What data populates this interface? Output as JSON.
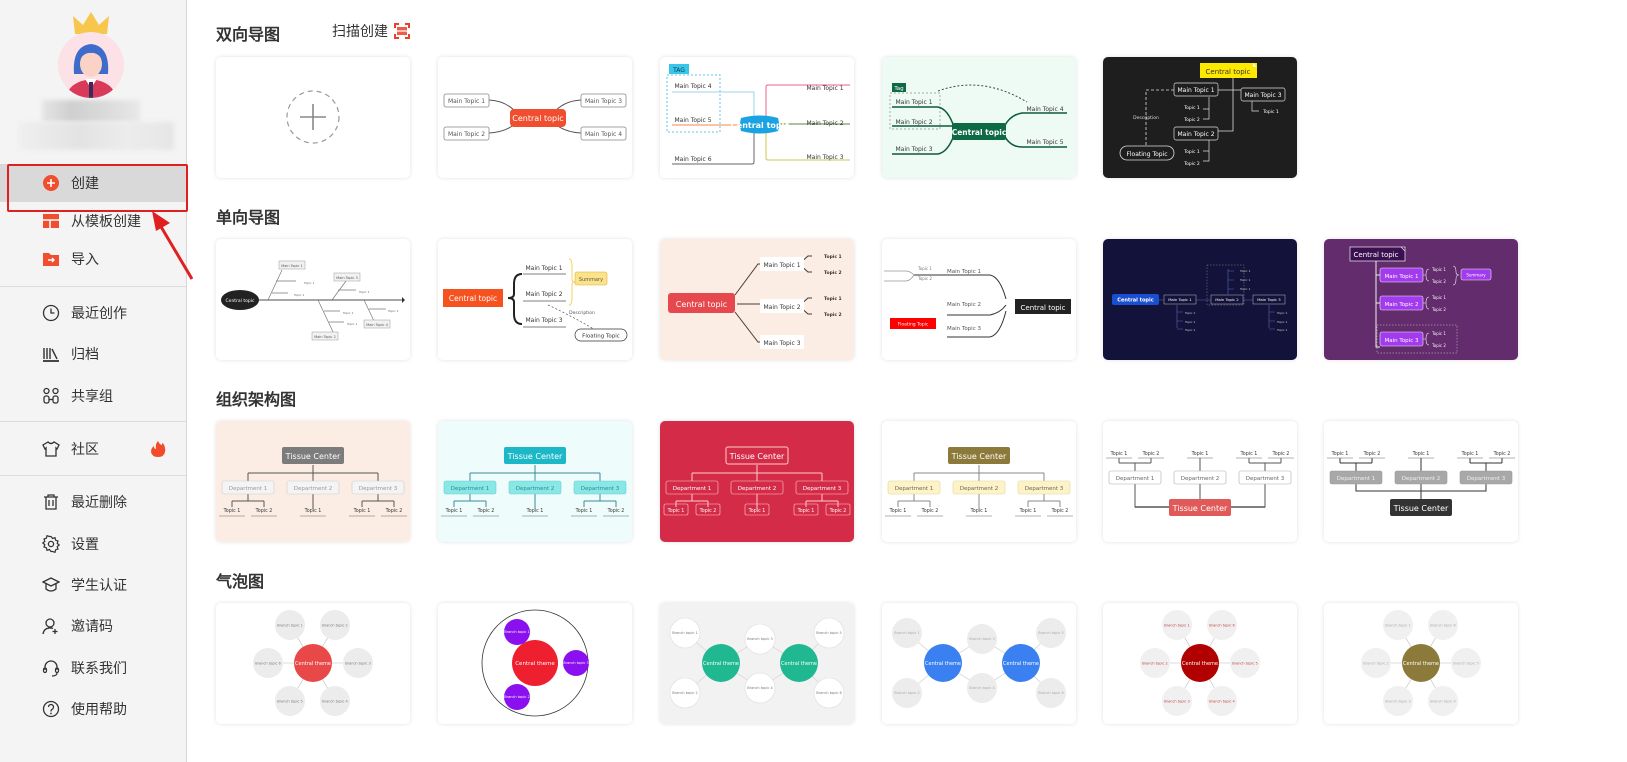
{
  "sidebar": {
    "items": [
      {
        "label": "创建",
        "icon": "plus-circle-icon",
        "active": true
      },
      {
        "label": "从模板创建",
        "icon": "template-icon"
      },
      {
        "label": "导入",
        "icon": "import-folder-icon"
      },
      {
        "label": "最近创作",
        "icon": "clock-icon"
      },
      {
        "label": "归档",
        "icon": "archive-books-icon"
      },
      {
        "label": "共享组",
        "icon": "share-group-icon"
      },
      {
        "label": "社区",
        "icon": "community-shirt-icon",
        "badge": "hot-fire-icon"
      },
      {
        "label": "最近删除",
        "icon": "trash-icon"
      },
      {
        "label": "设置",
        "icon": "gear-icon"
      },
      {
        "label": "学生认证",
        "icon": "graduation-cap-icon"
      },
      {
        "label": "邀请码",
        "icon": "user-add-icon"
      },
      {
        "label": "联系我们",
        "icon": "headset-icon"
      },
      {
        "label": "使用帮助",
        "icon": "help-circle-icon"
      }
    ]
  },
  "colors": {
    "accent": "#f04e2f",
    "highlight": "#e02020",
    "hot": "#f24a2a"
  },
  "sections": {
    "bidirectional": {
      "title": "双向导图",
      "scan_label": "扫描创建",
      "t1": {
        "center": "Central topic",
        "topics": [
          "Main Topic 1",
          "Main Topic 2",
          "Main Topic 3",
          "Main Topic 4"
        ]
      },
      "t2": {
        "tag": "TAG",
        "center": "Central topic",
        "topics": [
          "Main Topic 1",
          "Main Topic 2",
          "Main Topic 3",
          "Main Topic 4",
          "Main Topic 5",
          "Main Topic 6"
        ]
      },
      "t3": {
        "tag": "Tag",
        "center": "Central topic",
        "topics": [
          "Main Topic 1",
          "Main Topic 2",
          "Main Topic 3",
          "Main Topic 4",
          "Main Topic 5"
        ]
      },
      "t4": {
        "center": "Central topic",
        "main1": "Main Topic 1",
        "main2": "Main Topic 2",
        "main3": "Main Topic 3",
        "sub1": "Topic 1",
        "sub2": "Topic 2",
        "description": "Description",
        "floating": "Floating Topic"
      }
    },
    "unidirectional": {
      "title": "单向导图",
      "t0": {
        "center": "Central topic",
        "topics": [
          "Main Topic 1",
          "Main Topic 2",
          "Main Topic 3",
          "Main Topic 4"
        ],
        "sub": "Topic 1"
      },
      "t1": {
        "center": "Central topic",
        "topics": [
          "Main Topic 1",
          "Main Topic 2",
          "Main Topic 3"
        ],
        "summary": "Summary",
        "description": "Description",
        "floating": "Floating Topic"
      },
      "t2": {
        "center": "Central topic",
        "topics": [
          "Main Topic 1",
          "Main Topic 2",
          "Main Topic 3"
        ],
        "sub1": "Topic 1",
        "sub2": "Topic 2"
      },
      "t3": {
        "center": "Central topic",
        "topics": [
          "Main Topic 1",
          "Main Topic 2",
          "Main Topic 3"
        ],
        "sub1": "Topic 1",
        "sub2": "Topic 2",
        "floating": "Floating Topic"
      },
      "t4": {
        "center": "Central topic",
        "topics": [
          "Main Topic 1",
          "Main Topic 2",
          "Main Topic 3"
        ],
        "sub": "Topic 1"
      },
      "t5": {
        "center": "Central topic",
        "topics": [
          "Main Topic 1",
          "Main Topic 2",
          "Main Topic 3"
        ],
        "sub1": "Topic 1",
        "sub2": "Topic 2",
        "summary": "Summary"
      }
    },
    "org": {
      "title": "组织架构图",
      "center": "Tissue Center",
      "departments": [
        "Department 1",
        "Department 2",
        "Department 3"
      ],
      "sub1": "Topic 1",
      "sub2": "Topic 2"
    },
    "bubble": {
      "title": "气泡图",
      "center": "Central theme",
      "branches": [
        "Branch topic 1",
        "Branch topic 2",
        "Branch topic 3",
        "Branch topic 4",
        "Branch topic 5",
        "Branch topic 6"
      ]
    }
  }
}
